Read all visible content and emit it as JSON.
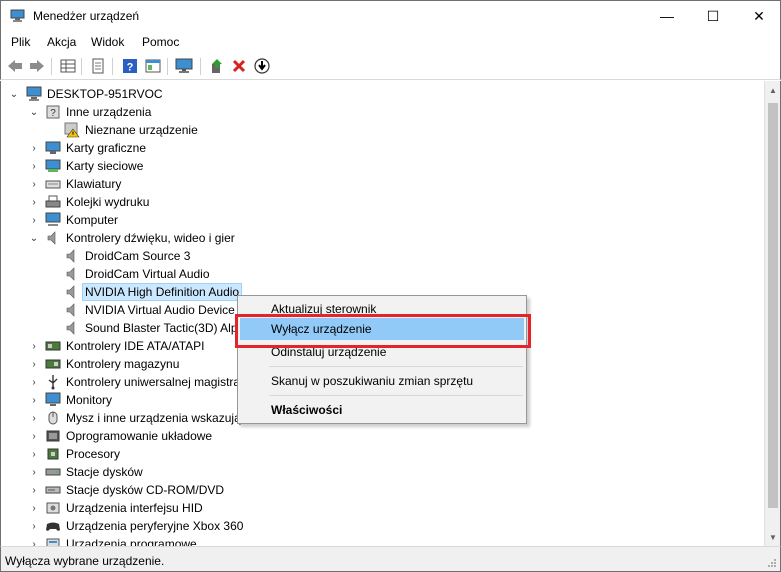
{
  "window": {
    "title": "Menedżer urządzeń",
    "minimize": "—",
    "maximize": "☐",
    "close": "✕"
  },
  "menu": [
    "Plik",
    "Akcja",
    "Widok",
    "Pomoc"
  ],
  "toolbar": {
    "icons": [
      "back-arrow-icon",
      "forward-arrow-icon",
      "properties-grid-icon",
      "document-icon",
      "help-icon",
      "view-icon",
      "monitor-icon",
      "update-driver-icon",
      "uninstall-x-icon",
      "download-icon"
    ]
  },
  "tree": {
    "root": "DESKTOP-951RVOC",
    "items": [
      {
        "label": "Inne urządzenia",
        "expanded": true,
        "icon": "unknown-device-icon"
      },
      {
        "label": "Nieznane urządzenie",
        "icon": "warning-device-icon"
      },
      {
        "label": "Karty graficzne",
        "icon": "display-adapter-icon"
      },
      {
        "label": "Karty sieciowe",
        "icon": "network-adapter-icon"
      },
      {
        "label": "Klawiatury",
        "icon": "keyboard-icon"
      },
      {
        "label": "Kolejki wydruku",
        "icon": "printer-icon"
      },
      {
        "label": "Komputer",
        "icon": "computer-icon"
      },
      {
        "label": "Kontrolery dźwięku, wideo i gier",
        "expanded": true,
        "icon": "speaker-icon"
      },
      {
        "label": "DroidCam Source 3",
        "icon": "speaker-icon"
      },
      {
        "label": "DroidCam Virtual Audio",
        "icon": "speaker-icon"
      },
      {
        "label": "NVIDIA High Definition Audio",
        "icon": "speaker-icon",
        "selected": true
      },
      {
        "label": "NVIDIA Virtual Audio Device",
        "icon": "speaker-icon"
      },
      {
        "label": "Sound Blaster Tactic(3D) Alp",
        "icon": "speaker-icon"
      },
      {
        "label": "Kontrolery IDE ATA/ATAPI",
        "icon": "ide-controller-icon"
      },
      {
        "label": "Kontrolery magazynu",
        "icon": "storage-controller-icon"
      },
      {
        "label": "Kontrolery uniwersalnej magistra",
        "icon": "usb-icon"
      },
      {
        "label": "Monitory",
        "icon": "monitor-icon"
      },
      {
        "label": "Mysz i inne urządzenia wskazując",
        "icon": "mouse-icon"
      },
      {
        "label": "Oprogramowanie układowe",
        "icon": "firmware-icon"
      },
      {
        "label": "Procesory",
        "icon": "processor-icon"
      },
      {
        "label": "Stacje dysków",
        "icon": "disk-drive-icon"
      },
      {
        "label": "Stacje dysków CD-ROM/DVD",
        "icon": "cdrom-icon"
      },
      {
        "label": "Urządzenia interfejsu HID",
        "icon": "hid-icon"
      },
      {
        "label": "Urządzenia peryferyjne Xbox 360",
        "icon": "gamepad-icon"
      },
      {
        "label": "Urządzenia programowe",
        "icon": "software-device-icon"
      }
    ]
  },
  "context_menu": {
    "items": [
      "Aktualizuj sterownik",
      "Wyłącz urządzenie",
      "Odinstaluj urządzenie",
      "Skanuj w poszukiwaniu zmian sprzętu",
      "Właściwości"
    ],
    "highlighted": "Wyłącz urządzenie",
    "highlight_color": "#91c9f7",
    "annotation_color": "#e3242b"
  },
  "status": "Wyłącza wybrane urządzenie.",
  "colors": {
    "selection_bg": "#cce8ff",
    "menu_bg": "#f2f2f2"
  }
}
